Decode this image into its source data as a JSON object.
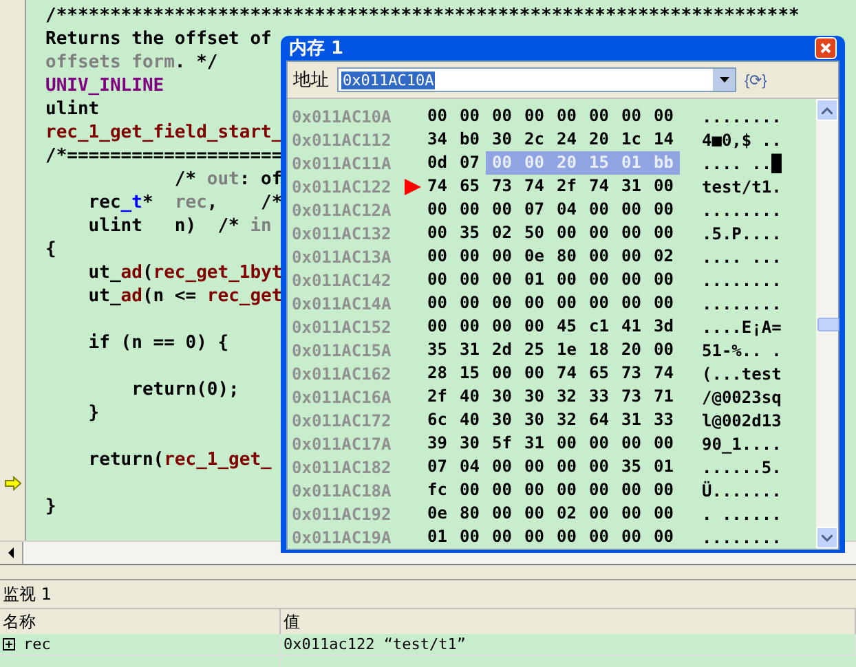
{
  "editor": {
    "lines": [
      {
        "kind": "code",
        "current": false,
        "segments": [
          {
            "kind": "plain",
            "text": "/*********************************************************************"
          }
        ]
      },
      {
        "kind": "code",
        "current": false,
        "segments": [
          {
            "kind": "plain",
            "text": "Returns the offset of"
          }
        ]
      },
      {
        "kind": "code",
        "current": false,
        "segments": [
          {
            "kind": "comment",
            "text": "offsets form"
          },
          {
            "kind": "plain",
            "text": ". */"
          }
        ]
      },
      {
        "kind": "code",
        "current": false,
        "segments": [
          {
            "kind": "macro",
            "text": "UNIV_INLINE"
          }
        ]
      },
      {
        "kind": "code",
        "current": false,
        "segments": [
          {
            "kind": "plain",
            "text": "ulint"
          }
        ]
      },
      {
        "kind": "code",
        "current": false,
        "segments": [
          {
            "kind": "function",
            "text": "rec_1_get_field_start_"
          }
        ]
      },
      {
        "kind": "code",
        "current": false,
        "segments": [
          {
            "kind": "plain",
            "text": "/*===================="
          }
        ]
      },
      {
        "kind": "code",
        "current": false,
        "segments": [
          {
            "kind": "plain",
            "text": "            /* "
          },
          {
            "kind": "comment",
            "text": "out"
          },
          {
            "kind": "plain",
            "text": ": of"
          }
        ]
      },
      {
        "kind": "code",
        "current": false,
        "segments": [
          {
            "kind": "plain",
            "text": "    rec"
          },
          {
            "kind": "type",
            "text": "_t"
          },
          {
            "kind": "plain",
            "text": "*  "
          },
          {
            "kind": "comment",
            "text": "rec"
          },
          {
            "kind": "plain",
            "text": ",    /*"
          }
        ]
      },
      {
        "kind": "code",
        "current": false,
        "segments": [
          {
            "kind": "plain",
            "text": "    ulint   n)  /* "
          },
          {
            "kind": "comment",
            "text": "in"
          }
        ]
      },
      {
        "kind": "code",
        "current": false,
        "segments": [
          {
            "kind": "plain",
            "text": "{"
          }
        ]
      },
      {
        "kind": "code",
        "current": false,
        "segments": [
          {
            "kind": "plain",
            "text": "    ut_"
          },
          {
            "kind": "function",
            "text": "ad"
          },
          {
            "kind": "plain",
            "text": "("
          },
          {
            "kind": "function",
            "text": "rec_get_1byt"
          }
        ]
      },
      {
        "kind": "code",
        "current": false,
        "segments": [
          {
            "kind": "plain",
            "text": "    ut_"
          },
          {
            "kind": "function",
            "text": "ad"
          },
          {
            "kind": "plain",
            "text": "(n <= "
          },
          {
            "kind": "function",
            "text": "rec_get"
          }
        ]
      },
      {
        "kind": "blank",
        "current": false
      },
      {
        "kind": "code",
        "current": false,
        "segments": [
          {
            "kind": "plain",
            "text": "    if (n == 0) {"
          }
        ]
      },
      {
        "kind": "blank",
        "current": false
      },
      {
        "kind": "code",
        "current": false,
        "segments": [
          {
            "kind": "plain",
            "text": "        return(0);"
          }
        ]
      },
      {
        "kind": "code",
        "current": false,
        "segments": [
          {
            "kind": "plain",
            "text": "    }"
          }
        ]
      },
      {
        "kind": "blank",
        "current": false
      },
      {
        "kind": "code",
        "current": false,
        "segments": [
          {
            "kind": "plain",
            "text": "    return("
          },
          {
            "kind": "function",
            "text": "rec_1_get_"
          }
        ]
      },
      {
        "kind": "blank",
        "current": true
      },
      {
        "kind": "code",
        "current": false,
        "segments": [
          {
            "kind": "plain",
            "text": "}"
          }
        ]
      }
    ]
  },
  "memory_window": {
    "title": "内存 1",
    "address_label": "地址",
    "address_value": "0x011AC10A",
    "refresh_glyph": "{⟳}",
    "rows": [
      {
        "address": "0x011AC10A",
        "current": false,
        "bytes": [
          "00",
          "00",
          "00",
          "00",
          "00",
          "00",
          "00",
          "00"
        ],
        "ascii": "........"
      },
      {
        "address": "0x011AC112",
        "current": false,
        "bytes": [
          "34",
          "b0",
          "30",
          "2c",
          "24",
          "20",
          "1c",
          "14"
        ],
        "ascii": "4■0,$ .."
      },
      {
        "address": "0x011AC11A",
        "current": false,
        "bytes": [
          "0d",
          "07"
        ],
        "selected_bytes": [
          "00",
          "00",
          "20",
          "15",
          "01",
          "bb"
        ],
        "ascii": ".... ..█"
      },
      {
        "address": "0x011AC122",
        "current": true,
        "bytes": [
          "74",
          "65",
          "73",
          "74",
          "2f",
          "74",
          "31",
          "00"
        ],
        "ascii": "test/t1."
      },
      {
        "address": "0x011AC12A",
        "current": false,
        "bytes": [
          "00",
          "00",
          "00",
          "07",
          "04",
          "00",
          "00",
          "00"
        ],
        "ascii": "........"
      },
      {
        "address": "0x011AC132",
        "current": false,
        "bytes": [
          "00",
          "35",
          "02",
          "50",
          "00",
          "00",
          "00",
          "00"
        ],
        "ascii": ".5.P...."
      },
      {
        "address": "0x011AC13A",
        "current": false,
        "bytes": [
          "00",
          "00",
          "00",
          "0e",
          "80",
          "00",
          "00",
          "02"
        ],
        "ascii": ".... ..."
      },
      {
        "address": "0x011AC142",
        "current": false,
        "bytes": [
          "00",
          "00",
          "00",
          "01",
          "00",
          "00",
          "00",
          "00"
        ],
        "ascii": "........"
      },
      {
        "address": "0x011AC14A",
        "current": false,
        "bytes": [
          "00",
          "00",
          "00",
          "00",
          "00",
          "00",
          "00",
          "00"
        ],
        "ascii": "........"
      },
      {
        "address": "0x011AC152",
        "current": false,
        "bytes": [
          "00",
          "00",
          "00",
          "00",
          "45",
          "c1",
          "41",
          "3d"
        ],
        "ascii": "....E¡A="
      },
      {
        "address": "0x011AC15A",
        "current": false,
        "bytes": [
          "35",
          "31",
          "2d",
          "25",
          "1e",
          "18",
          "20",
          "00"
        ],
        "ascii": "51-%.. ."
      },
      {
        "address": "0x011AC162",
        "current": false,
        "bytes": [
          "28",
          "15",
          "00",
          "00",
          "74",
          "65",
          "73",
          "74"
        ],
        "ascii": "(...test"
      },
      {
        "address": "0x011AC16A",
        "current": false,
        "bytes": [
          "2f",
          "40",
          "30",
          "30",
          "32",
          "33",
          "73",
          "71"
        ],
        "ascii": "/@0023sq"
      },
      {
        "address": "0x011AC172",
        "current": false,
        "bytes": [
          "6c",
          "40",
          "30",
          "30",
          "32",
          "64",
          "31",
          "33"
        ],
        "ascii": "l@002d13"
      },
      {
        "address": "0x011AC17A",
        "current": false,
        "bytes": [
          "39",
          "30",
          "5f",
          "31",
          "00",
          "00",
          "00",
          "00"
        ],
        "ascii": "90_1...."
      },
      {
        "address": "0x011AC182",
        "current": false,
        "bytes": [
          "07",
          "04",
          "00",
          "00",
          "00",
          "00",
          "35",
          "01"
        ],
        "ascii": "......5."
      },
      {
        "address": "0x011AC18A",
        "current": false,
        "bytes": [
          "fc",
          "00",
          "00",
          "00",
          "00",
          "00",
          "00",
          "00"
        ],
        "ascii": "Ü......."
      },
      {
        "address": "0x011AC192",
        "current": false,
        "bytes": [
          "0e",
          "80",
          "00",
          "00",
          "02",
          "00",
          "00",
          "00"
        ],
        "ascii": ". ......"
      },
      {
        "address": "0x011AC19A",
        "current": false,
        "bytes": [
          "01",
          "00",
          "00",
          "00",
          "00",
          "00",
          "00",
          "00"
        ],
        "ascii": "........"
      }
    ]
  },
  "watch_panel": {
    "title": "监视 1",
    "columns": [
      "名称",
      "值"
    ],
    "rows": [
      {
        "name": "rec",
        "value": "0x011ac122 “test/t1”",
        "expanded": false
      }
    ]
  }
}
